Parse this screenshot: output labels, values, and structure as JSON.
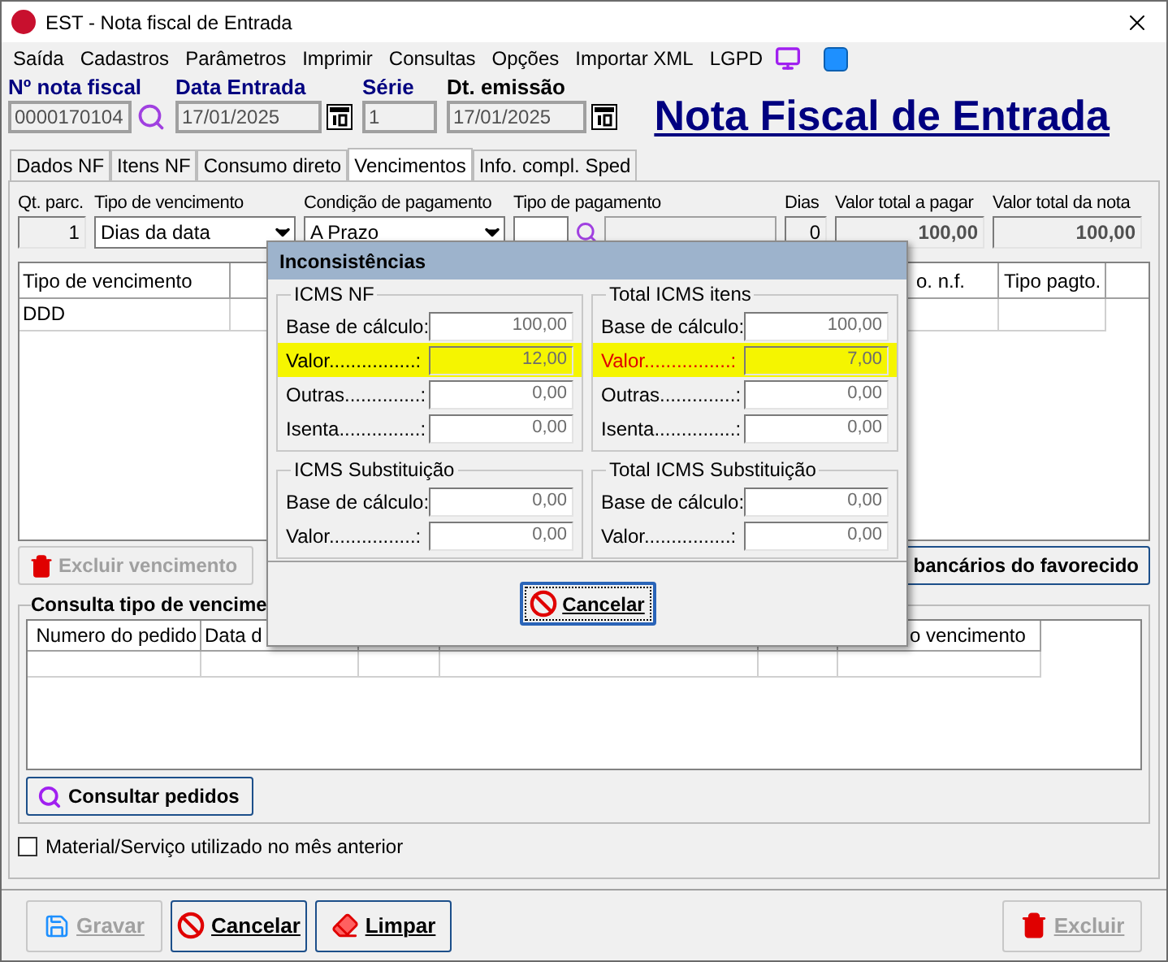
{
  "window": {
    "title": "EST - Nota fiscal de Entrada"
  },
  "menu": [
    "Saída",
    "Cadastros",
    "Parâmetros",
    "Imprimir",
    "Consultas",
    "Opções",
    "Importar XML",
    "LGPD"
  ],
  "header_fields": [
    {
      "label": "Nº nota fiscal",
      "value": "0000170104",
      "kind": "search"
    },
    {
      "label": "Data Entrada",
      "value": "17/01/2025",
      "kind": "date"
    },
    {
      "label": "Série",
      "value": "1",
      "kind": "plain"
    },
    {
      "label": "Dt. emissão",
      "value": "17/01/2025",
      "kind": "date"
    }
  ],
  "page_title": "Nota Fiscal de Entrada",
  "tabs": [
    {
      "label": "Dados NF",
      "selected": false
    },
    {
      "label": "Itens NF",
      "selected": false
    },
    {
      "label": "Consumo direto",
      "selected": false
    },
    {
      "label": "Vencimentos",
      "selected": true
    },
    {
      "label": "Info. compl. Sped",
      "selected": false
    }
  ],
  "fields": [
    {
      "label": "Qt. parc.",
      "value": "1",
      "kind": "number"
    },
    {
      "label": "Tipo de vencimento",
      "value": "Dias da data",
      "kind": "select"
    },
    {
      "label": "Condição de pagamento",
      "value": "A Prazo",
      "kind": "select"
    },
    {
      "label": "Tipo de pagamento",
      "kind": "lookup"
    },
    {
      "label": "Dias",
      "value": "0",
      "kind": "number"
    },
    {
      "label": "Valor total a pagar",
      "value": "100,00",
      "kind": "total"
    },
    {
      "label": "Valor total da nota",
      "value": "100,00",
      "kind": "total"
    }
  ],
  "installments_table": {
    "columns": [
      "Tipo de vencimento",
      "o. n.f.",
      "Tipo pagto."
    ],
    "rows": [
      [
        "DDD",
        "",
        ""
      ]
    ]
  },
  "delete_installment_button": {
    "label": "Excluir vencimento",
    "disabled": true
  },
  "bank_button": {
    "label": "bancários do favorecido"
  },
  "orders_group": {
    "title": "Consulta tipo de vencime",
    "columns": [
      "Numero do pedido",
      "Data d",
      "o vencimento"
    ],
    "button": "Consultar pedidos"
  },
  "previous_month": {
    "label": "Material/Serviço utilizado no mês anterior",
    "checked": false
  },
  "footer_buttons": [
    {
      "label": "Gravar",
      "kind": "save",
      "disabled": true
    },
    {
      "label": "Cancelar",
      "kind": "cancel",
      "disabled": false
    },
    {
      "label": "Limpar",
      "kind": "clear",
      "disabled": false
    },
    {
      "label": "Excluir",
      "kind": "delete",
      "disabled": true
    }
  ],
  "dialog": {
    "title": "Inconsistências",
    "groups": [
      {
        "title": "ICMS NF",
        "rows": [
          {
            "label": "Base de cálculo:",
            "value": "100,00",
            "highlighted": false,
            "error": false
          },
          {
            "label": "Valor................:",
            "value": "12,00",
            "highlighted": true,
            "error": false
          },
          {
            "label": "Outras..............:",
            "value": "0,00",
            "highlighted": false,
            "error": false
          },
          {
            "label": "Isenta...............:",
            "value": "0,00",
            "highlighted": false,
            "error": false
          }
        ]
      },
      {
        "title": "Total ICMS itens",
        "rows": [
          {
            "label": "Base de cálculo:",
            "value": "100,00",
            "highlighted": false,
            "error": false
          },
          {
            "label": "Valor................:",
            "value": "7,00",
            "highlighted": true,
            "error": true
          },
          {
            "label": "Outras..............:",
            "value": "0,00",
            "highlighted": false,
            "error": false
          },
          {
            "label": "Isenta...............:",
            "value": "0,00",
            "highlighted": false,
            "error": false
          }
        ]
      },
      {
        "title": "ICMS Substituição",
        "rows": [
          {
            "label": "Base de cálculo:",
            "value": "0,00",
            "highlighted": false,
            "error": false
          },
          {
            "label": "Valor................:",
            "value": "0,00",
            "highlighted": false,
            "error": false
          }
        ]
      },
      {
        "title": "Total ICMS Substituição",
        "rows": [
          {
            "label": "Base de cálculo:",
            "value": "0,00",
            "highlighted": false,
            "error": false
          },
          {
            "label": "Valor................:",
            "value": "0,00",
            "highlighted": false,
            "error": false
          }
        ]
      }
    ],
    "button": "Cancelar"
  }
}
